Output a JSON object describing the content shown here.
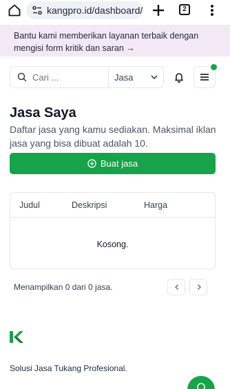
{
  "browser": {
    "url": "kangpro.id/dashboard/ha",
    "tab_count": "2"
  },
  "banner": {
    "text": "Bantu kami memberikan layanan terbaik dengan mengisi form kritik dan saran →"
  },
  "search": {
    "placeholder": "Cari ...",
    "category_value": "Jasa"
  },
  "page": {
    "title": "Jasa Saya",
    "subtitle": "Daftar jasa yang kamu sediakan. Maksimal iklan jasa yang bisa dibuat adalah 10.",
    "create_label": "Buat jasa"
  },
  "table": {
    "columns": [
      "Judul",
      "Deskripsi",
      "Harga"
    ],
    "empty_text": "Kosong."
  },
  "pagination": {
    "text": "Menampilkan 0 dari 0 jasa."
  },
  "footer": {
    "tagline": "Solusi Jasa Tukang Profesional."
  },
  "colors": {
    "accent": "#16a34a",
    "banner_bg": "#f3e8f6",
    "border": "#e5e7eb"
  },
  "icons": {
    "home": "home-icon",
    "site_settings": "site-settings-icon",
    "new_tab": "plus-icon",
    "overflow": "kebab-menu-icon",
    "search": "search-icon",
    "dropdown": "chevron-down-icon",
    "notifications": "bell-icon",
    "menu": "hamburger-icon",
    "create": "plus-circle-icon",
    "prev": "chevron-left-icon",
    "next": "chevron-right-icon",
    "logo": "kangpro-logo-icon",
    "chat": "chat-icon"
  }
}
